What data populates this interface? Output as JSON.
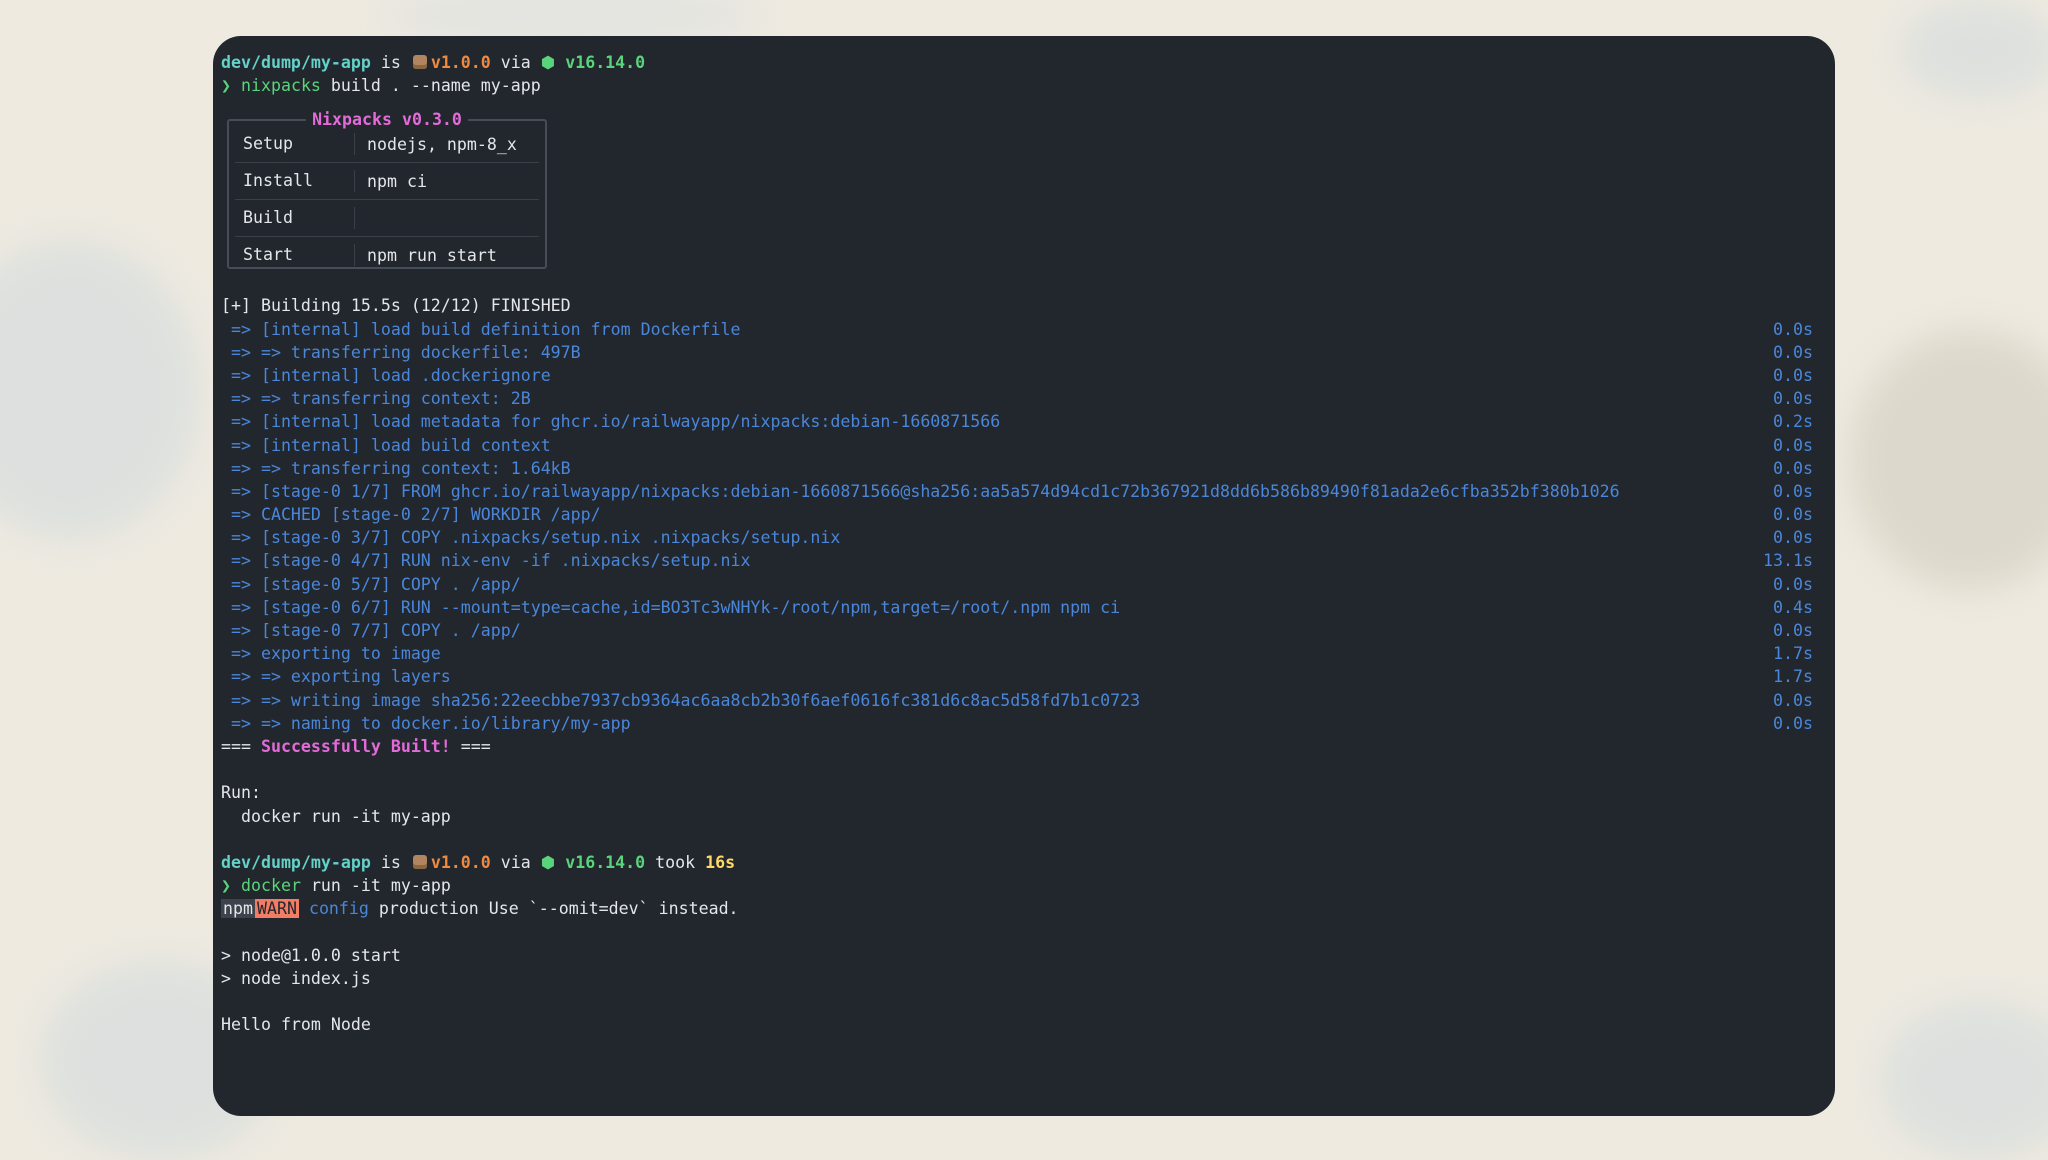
{
  "prompt1": {
    "dir": "dev/dump/my-app",
    "is": " is ",
    "version": "v1.0.0",
    "via": " via ",
    "node": "v16.14.0",
    "arrow": "❯",
    "cmd": "nixpacks",
    "args": " build . --name my-app"
  },
  "plan": {
    "title": "Nixpacks v0.3.0",
    "rows": [
      {
        "key": "Setup",
        "value": "nodejs, npm-8_x"
      },
      {
        "key": "Install",
        "value": "npm ci"
      },
      {
        "key": "Build",
        "value": ""
      },
      {
        "key": "Start",
        "value": "npm run start"
      }
    ]
  },
  "build": {
    "header": "[+] Building 15.5s (12/12) FINISHED",
    "steps": [
      {
        "text": " => [internal] load build definition from Dockerfile",
        "time": "0.0s"
      },
      {
        "text": " => => transferring dockerfile: 497B",
        "time": "0.0s"
      },
      {
        "text": " => [internal] load .dockerignore",
        "time": "0.0s"
      },
      {
        "text": " => => transferring context: 2B",
        "time": "0.0s"
      },
      {
        "text": " => [internal] load metadata for ghcr.io/railwayapp/nixpacks:debian-1660871566",
        "time": "0.2s"
      },
      {
        "text": " => [internal] load build context",
        "time": "0.0s"
      },
      {
        "text": " => => transferring context: 1.64kB",
        "time": "0.0s"
      },
      {
        "text": " => [stage-0 1/7] FROM ghcr.io/railwayapp/nixpacks:debian-1660871566@sha256:aa5a574d94cd1c72b367921d8dd6b586b89490f81ada2e6cfba352bf380b1026",
        "time": "0.0s"
      },
      {
        "text": " => CACHED [stage-0 2/7] WORKDIR /app/",
        "time": "0.0s"
      },
      {
        "text": " => [stage-0 3/7] COPY .nixpacks/setup.nix .nixpacks/setup.nix",
        "time": "0.0s"
      },
      {
        "text": " => [stage-0 4/7] RUN nix-env -if .nixpacks/setup.nix",
        "time": "13.1s"
      },
      {
        "text": " => [stage-0 5/7] COPY . /app/",
        "time": "0.0s"
      },
      {
        "text": " => [stage-0 6/7] RUN --mount=type=cache,id=BO3Tc3wNHYk-/root/npm,target=/root/.npm npm ci",
        "time": "0.4s"
      },
      {
        "text": " => [stage-0 7/7] COPY . /app/",
        "time": "0.0s"
      },
      {
        "text": " => exporting to image",
        "time": "1.7s"
      },
      {
        "text": " => => exporting layers",
        "time": "1.7s"
      },
      {
        "text": " => => writing image sha256:22eecbbe7937cb9364ac6aa8cb2b30f6aef0616fc381d6c8ac5d58fd7b1c0723",
        "time": "0.0s"
      },
      {
        "text": " => => naming to docker.io/library/my-app",
        "time": "0.0s"
      }
    ],
    "success_prefix": "=== ",
    "success": "Successfully Built!",
    "success_suffix": " ===",
    "run_label": "Run:",
    "run_cmd": "  docker run -it my-app"
  },
  "prompt2": {
    "dir": "dev/dump/my-app",
    "is": " is ",
    "version": "v1.0.0",
    "via": " via ",
    "node": "v16.14.0",
    "took_label": " took ",
    "took": "16s",
    "arrow": "❯",
    "cmd": "docker",
    "args": " run -it my-app"
  },
  "output": {
    "npm": "npm",
    "warn": "WARN",
    "config": "config",
    "warn_msg": " production Use `--omit=dev` instead.",
    "script1": "> node@1.0.0 start",
    "script2": "> node index.js",
    "hello": "Hello from Node"
  }
}
